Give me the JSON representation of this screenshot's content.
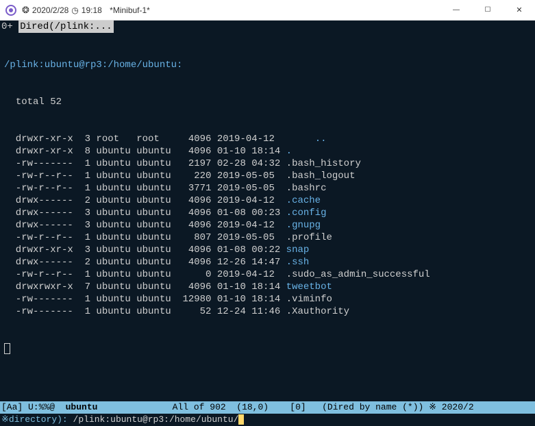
{
  "titlebar": {
    "date": "2020/2/28",
    "time": "19:18",
    "buffer": "*Minibuf-1*"
  },
  "tabline": {
    "prefix": "0+",
    "active": "Dired(/plink:..."
  },
  "dired": {
    "path": "/plink:ubuntu@rp3:/home/ubuntu:",
    "total": "total 52",
    "rows": [
      {
        "perm": "drwxr-xr-x",
        "links": "3",
        "owner": "root",
        "group": "root  ",
        "size": "  4096",
        "date": "2019-04-12      ",
        "name": "..",
        "type": "dir"
      },
      {
        "perm": "drwxr-xr-x",
        "links": "8",
        "owner": "ubuntu",
        "group": "ubuntu",
        "size": "  4096",
        "date": "01-10 18:14",
        "name": ".",
        "type": "dir"
      },
      {
        "perm": "-rw-------",
        "links": "1",
        "owner": "ubuntu",
        "group": "ubuntu",
        "size": "  2197",
        "date": "02-28 04:32",
        "name": ".bash_history",
        "type": "file"
      },
      {
        "perm": "-rw-r--r--",
        "links": "1",
        "owner": "ubuntu",
        "group": "ubuntu",
        "size": "   220",
        "date": "2019-05-05 ",
        "name": ".bash_logout",
        "type": "file"
      },
      {
        "perm": "-rw-r--r--",
        "links": "1",
        "owner": "ubuntu",
        "group": "ubuntu",
        "size": "  3771",
        "date": "2019-05-05 ",
        "name": ".bashrc",
        "type": "file"
      },
      {
        "perm": "drwx------",
        "links": "2",
        "owner": "ubuntu",
        "group": "ubuntu",
        "size": "  4096",
        "date": "2019-04-12 ",
        "name": ".cache",
        "type": "dir"
      },
      {
        "perm": "drwx------",
        "links": "3",
        "owner": "ubuntu",
        "group": "ubuntu",
        "size": "  4096",
        "date": "01-08 00:23",
        "name": ".config",
        "type": "dir"
      },
      {
        "perm": "drwx------",
        "links": "3",
        "owner": "ubuntu",
        "group": "ubuntu",
        "size": "  4096",
        "date": "2019-04-12 ",
        "name": ".gnupg",
        "type": "dir"
      },
      {
        "perm": "-rw-r--r--",
        "links": "1",
        "owner": "ubuntu",
        "group": "ubuntu",
        "size": "   807",
        "date": "2019-05-05 ",
        "name": ".profile",
        "type": "file"
      },
      {
        "perm": "drwxr-xr-x",
        "links": "3",
        "owner": "ubuntu",
        "group": "ubuntu",
        "size": "  4096",
        "date": "01-08 00:22",
        "name": "snap",
        "type": "dir"
      },
      {
        "perm": "drwx------",
        "links": "2",
        "owner": "ubuntu",
        "group": "ubuntu",
        "size": "  4096",
        "date": "12-26 14:47",
        "name": ".ssh",
        "type": "dir"
      },
      {
        "perm": "-rw-r--r--",
        "links": "1",
        "owner": "ubuntu",
        "group": "ubuntu",
        "size": "     0",
        "date": "2019-04-12 ",
        "name": ".sudo_as_admin_successful",
        "type": "file"
      },
      {
        "perm": "drwxrwxr-x",
        "links": "7",
        "owner": "ubuntu",
        "group": "ubuntu",
        "size": "  4096",
        "date": "01-10 18:14",
        "name": "tweetbot",
        "type": "dir"
      },
      {
        "perm": "-rw-------",
        "links": "1",
        "owner": "ubuntu",
        "group": "ubuntu",
        "size": " 12980",
        "date": "01-10 18:14",
        "name": ".viminfo",
        "type": "file"
      },
      {
        "perm": "-rw-------",
        "links": "1",
        "owner": "ubuntu",
        "group": "ubuntu",
        "size": "    52",
        "date": "12-24 11:46",
        "name": ".Xauthority",
        "type": "file"
      }
    ]
  },
  "modeline": {
    "left": "[Aa] U:%%@  ",
    "buffer": "ubuntu",
    "spacer": "              ",
    "pos": "All of 902  (18,0)    [0]   (Dired by name (*)) ※ 2020/2"
  },
  "minibuf": {
    "prompt_prefix": "※",
    "prompt_text": "directory): ",
    "input": "/plink:ubuntu@rp3:/home/ubuntu/"
  }
}
